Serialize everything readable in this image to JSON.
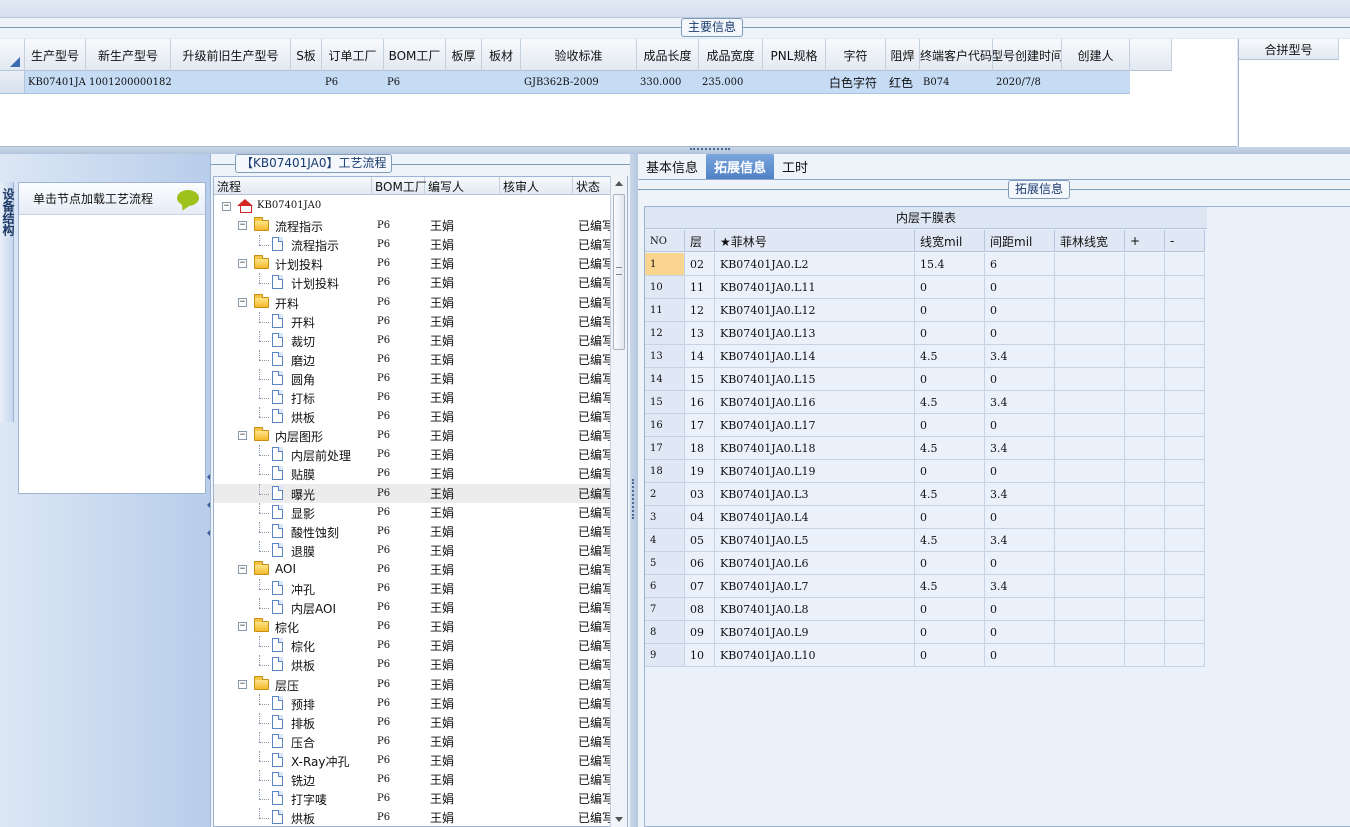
{
  "main_info": {
    "title": "主要信息",
    "columns": [
      "生产型号",
      "新生产型号",
      "升级前旧生产型号",
      "S板",
      "订单工厂",
      "BOM工厂",
      "板厚",
      "板材",
      "验收标准",
      "成品长度",
      "成品宽度",
      "PNL规格",
      "字符",
      "阻焊",
      "终端客户代码",
      "型号创建时间",
      "创建人"
    ],
    "row": [
      "KB07401JA0",
      "10012000001826",
      "",
      "",
      "P6",
      "P6",
      "",
      "",
      "GJB362B-2009",
      "330.000",
      "235.000",
      "",
      "白色字符",
      "红色",
      "B074",
      "2020/7/8",
      ""
    ],
    "merge_header": "合拼型号"
  },
  "left_panel": {
    "vertical_tab": "设备结构",
    "load_hint": "单击节点加载工艺流程"
  },
  "process_tree": {
    "title": "【KB07401JA0】工艺流程",
    "columns": [
      "流程",
      "BOM工厂",
      "编写人",
      "核审人",
      "状态"
    ],
    "nodes": [
      {
        "label": "KB07401JA0",
        "type": "root",
        "level": 0,
        "factory": "",
        "writer": "",
        "reviewer": "",
        "status": ""
      },
      {
        "label": "流程指示",
        "type": "folder",
        "level": 1,
        "factory": "P6",
        "writer": "王娟",
        "reviewer": "",
        "status": "已编写"
      },
      {
        "label": "流程指示",
        "type": "doc",
        "level": 2,
        "factory": "P6",
        "writer": "王娟",
        "reviewer": "",
        "status": "已编写"
      },
      {
        "label": "计划投料",
        "type": "folder",
        "level": 1,
        "factory": "P6",
        "writer": "王娟",
        "reviewer": "",
        "status": "已编写"
      },
      {
        "label": "计划投料",
        "type": "doc",
        "level": 2,
        "factory": "P6",
        "writer": "王娟",
        "reviewer": "",
        "status": "已编写"
      },
      {
        "label": "开料",
        "type": "folder",
        "level": 1,
        "factory": "P6",
        "writer": "王娟",
        "reviewer": "",
        "status": "已编写"
      },
      {
        "label": "开料",
        "type": "doc",
        "level": 2,
        "factory": "P6",
        "writer": "王娟",
        "reviewer": "",
        "status": "已编写"
      },
      {
        "label": "裁切",
        "type": "doc",
        "level": 2,
        "factory": "P6",
        "writer": "王娟",
        "reviewer": "",
        "status": "已编写"
      },
      {
        "label": "磨边",
        "type": "doc",
        "level": 2,
        "factory": "P6",
        "writer": "王娟",
        "reviewer": "",
        "status": "已编写"
      },
      {
        "label": "圆角",
        "type": "doc",
        "level": 2,
        "factory": "P6",
        "writer": "王娟",
        "reviewer": "",
        "status": "已编写"
      },
      {
        "label": "打标",
        "type": "doc",
        "level": 2,
        "factory": "P6",
        "writer": "王娟",
        "reviewer": "",
        "status": "已编写"
      },
      {
        "label": "烘板",
        "type": "doc",
        "level": 2,
        "factory": "P6",
        "writer": "王娟",
        "reviewer": "",
        "status": "已编写"
      },
      {
        "label": "内层图形",
        "type": "folder",
        "level": 1,
        "factory": "P6",
        "writer": "王娟",
        "reviewer": "",
        "status": "已编写"
      },
      {
        "label": "内层前处理",
        "type": "doc",
        "level": 2,
        "factory": "P6",
        "writer": "王娟",
        "reviewer": "",
        "status": "已编写"
      },
      {
        "label": "贴膜",
        "type": "doc",
        "level": 2,
        "factory": "P6",
        "writer": "王娟",
        "reviewer": "",
        "status": "已编写"
      },
      {
        "label": "曝光",
        "type": "doc",
        "level": 2,
        "factory": "P6",
        "writer": "王娟",
        "reviewer": "",
        "status": "已编写",
        "selected": true
      },
      {
        "label": "显影",
        "type": "doc",
        "level": 2,
        "factory": "P6",
        "writer": "王娟",
        "reviewer": "",
        "status": "已编写"
      },
      {
        "label": "酸性蚀刻",
        "type": "doc",
        "level": 2,
        "factory": "P6",
        "writer": "王娟",
        "reviewer": "",
        "status": "已编写"
      },
      {
        "label": "退膜",
        "type": "doc",
        "level": 2,
        "factory": "P6",
        "writer": "王娟",
        "reviewer": "",
        "status": "已编写"
      },
      {
        "label": "AOI",
        "type": "folder",
        "level": 1,
        "factory": "P6",
        "writer": "王娟",
        "reviewer": "",
        "status": "已编写"
      },
      {
        "label": "冲孔",
        "type": "doc",
        "level": 2,
        "factory": "P6",
        "writer": "王娟",
        "reviewer": "",
        "status": "已编写"
      },
      {
        "label": "内层AOI",
        "type": "doc",
        "level": 2,
        "factory": "P6",
        "writer": "王娟",
        "reviewer": "",
        "status": "已编写"
      },
      {
        "label": "棕化",
        "type": "folder",
        "level": 1,
        "factory": "P6",
        "writer": "王娟",
        "reviewer": "",
        "status": "已编写"
      },
      {
        "label": "棕化",
        "type": "doc",
        "level": 2,
        "factory": "P6",
        "writer": "王娟",
        "reviewer": "",
        "status": "已编写"
      },
      {
        "label": "烘板",
        "type": "doc",
        "level": 2,
        "factory": "P6",
        "writer": "王娟",
        "reviewer": "",
        "status": "已编写"
      },
      {
        "label": "层压",
        "type": "folder",
        "level": 1,
        "factory": "P6",
        "writer": "王娟",
        "reviewer": "",
        "status": "已编写"
      },
      {
        "label": "预排",
        "type": "doc",
        "level": 2,
        "factory": "P6",
        "writer": "王娟",
        "reviewer": "",
        "status": "已编写"
      },
      {
        "label": "排板",
        "type": "doc",
        "level": 2,
        "factory": "P6",
        "writer": "王娟",
        "reviewer": "",
        "status": "已编写"
      },
      {
        "label": "压合",
        "type": "doc",
        "level": 2,
        "factory": "P6",
        "writer": "王娟",
        "reviewer": "",
        "status": "已编写"
      },
      {
        "label": "X-Ray冲孔",
        "type": "doc",
        "level": 2,
        "factory": "P6",
        "writer": "王娟",
        "reviewer": "",
        "status": "已编写"
      },
      {
        "label": "铣边",
        "type": "doc",
        "level": 2,
        "factory": "P6",
        "writer": "王娟",
        "reviewer": "",
        "status": "已编写"
      },
      {
        "label": "打字唛",
        "type": "doc",
        "level": 2,
        "factory": "P6",
        "writer": "王娟",
        "reviewer": "",
        "status": "已编写"
      },
      {
        "label": "烘板",
        "type": "doc",
        "level": 2,
        "factory": "P6",
        "writer": "王娟",
        "reviewer": "",
        "status": "已编写"
      }
    ]
  },
  "right_panel": {
    "tabs": [
      {
        "label": "基本信息",
        "active": false
      },
      {
        "label": "拓展信息",
        "active": true
      },
      {
        "label": "工时",
        "active": false
      }
    ],
    "section_title": "拓展信息",
    "table_caption": "内层干膜表",
    "columns": [
      "NO",
      "层",
      "★菲林号",
      "线宽mil",
      "间距mil",
      "菲林线宽",
      "+",
      "-"
    ],
    "rows": [
      [
        "1",
        "02",
        "KB07401JA0.L2",
        "15.4",
        "6",
        "",
        "",
        ""
      ],
      [
        "10",
        "11",
        "KB07401JA0.L11",
        "0",
        "0",
        "",
        "",
        ""
      ],
      [
        "11",
        "12",
        "KB07401JA0.L12",
        "0",
        "0",
        "",
        "",
        ""
      ],
      [
        "12",
        "13",
        "KB07401JA0.L13",
        "0",
        "0",
        "",
        "",
        ""
      ],
      [
        "13",
        "14",
        "KB07401JA0.L14",
        "4.5",
        "3.4",
        "",
        "",
        ""
      ],
      [
        "14",
        "15",
        "KB07401JA0.L15",
        "0",
        "0",
        "",
        "",
        ""
      ],
      [
        "15",
        "16",
        "KB07401JA0.L16",
        "4.5",
        "3.4",
        "",
        "",
        ""
      ],
      [
        "16",
        "17",
        "KB07401JA0.L17",
        "0",
        "0",
        "",
        "",
        ""
      ],
      [
        "17",
        "18",
        "KB07401JA0.L18",
        "4.5",
        "3.4",
        "",
        "",
        ""
      ],
      [
        "18",
        "19",
        "KB07401JA0.L19",
        "0",
        "0",
        "",
        "",
        ""
      ],
      [
        "2",
        "03",
        "KB07401JA0.L3",
        "4.5",
        "3.4",
        "",
        "",
        ""
      ],
      [
        "3",
        "04",
        "KB07401JA0.L4",
        "0",
        "0",
        "",
        "",
        ""
      ],
      [
        "4",
        "05",
        "KB07401JA0.L5",
        "4.5",
        "3.4",
        "",
        "",
        ""
      ],
      [
        "5",
        "06",
        "KB07401JA0.L6",
        "0",
        "0",
        "",
        "",
        ""
      ],
      [
        "6",
        "07",
        "KB07401JA0.L7",
        "4.5",
        "3.4",
        "",
        "",
        ""
      ],
      [
        "7",
        "08",
        "KB07401JA0.L8",
        "0",
        "0",
        "",
        "",
        ""
      ],
      [
        "8",
        "09",
        "KB07401JA0.L9",
        "0",
        "0",
        "",
        "",
        ""
      ],
      [
        "9",
        "10",
        "KB07401JA0.L10",
        "0",
        "0",
        "",
        "",
        ""
      ]
    ]
  }
}
